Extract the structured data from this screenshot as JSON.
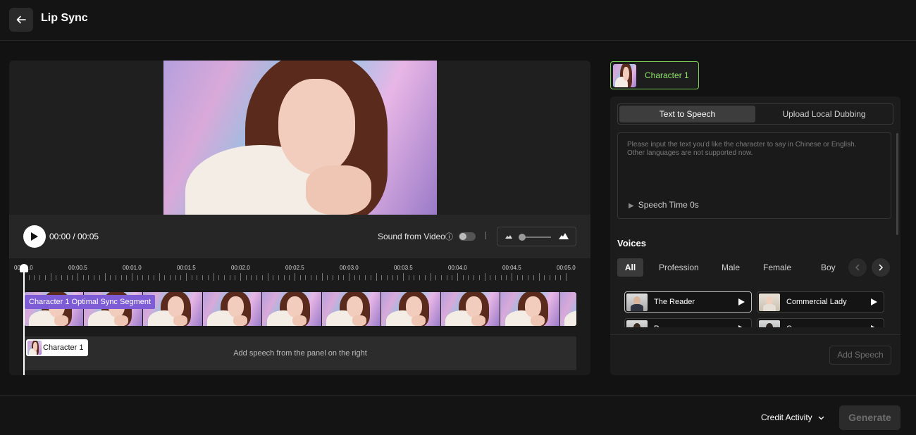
{
  "header": {
    "title": "Lip Sync",
    "back_icon": "arrow-left-icon"
  },
  "player": {
    "time": "00:00 / 00:05",
    "sound_from_video_label": "Sound from Video",
    "sound_from_video_enabled": false,
    "zoom_level": 0.1
  },
  "timeline": {
    "ticks": [
      "00:00.0",
      "00:00.5",
      "00:01.0",
      "00:01.5",
      "00:02.0",
      "00:02.5",
      "00:03.0",
      "00:03.5",
      "00:04.0",
      "00:04.5",
      "00:05.0"
    ],
    "segment_label": "Character 1 Optimal Sync Segment",
    "speech_chip_label": "Character 1",
    "speech_hint": "Add speech from the panel on the right"
  },
  "character_tab": {
    "label": "Character 1"
  },
  "tabs": {
    "tts": "Text to Speech",
    "upload": "Upload Local Dubbing"
  },
  "text_input": {
    "placeholder": "Please input the text you'd like the character to say in Chinese or English. Other languages are not supported now.",
    "speech_time": "Speech Time 0s"
  },
  "voices": {
    "title": "Voices",
    "filters": [
      "All",
      "Profession",
      "Male",
      "Female",
      "Boy"
    ],
    "active_filter": "All",
    "items": [
      {
        "name": "The Reader",
        "selected": true
      },
      {
        "name": "Commercial Lady",
        "selected": false
      },
      {
        "name": "P",
        "selected": false
      },
      {
        "name": "C",
        "selected": false
      }
    ]
  },
  "add_speech_label": "Add Speech",
  "footer": {
    "credit_activity": "Credit Activity",
    "generate": "Generate"
  },
  "colors": {
    "accent_green": "#7cd05a",
    "segment_purple": "#7d5cd6"
  }
}
